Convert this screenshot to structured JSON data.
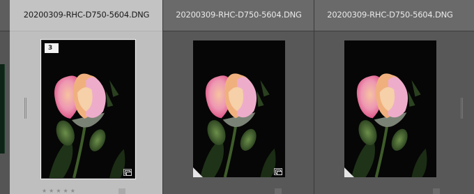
{
  "grid": {
    "cells": [
      {
        "filename": "20200309-RHC-D750-5604.DNG",
        "index_badge": "3",
        "selected": true,
        "rating_stars": "★★★★★"
      },
      {
        "filename": "20200309-RHC-D750-5604.DNG",
        "selected": false,
        "rating_stars": ""
      },
      {
        "filename": "20200309-RHC-D750-5604.DNG",
        "selected": false,
        "rating_stars": ""
      }
    ]
  },
  "colors": {
    "selected_cell_bg": "#bfbfbf",
    "normal_cell_bg": "#585858",
    "grid_bg": "#4a4a4a"
  },
  "icons": {
    "stack": "stack-icon",
    "corner_flag": "corner-flag-icon",
    "grip": "grip-icon"
  }
}
